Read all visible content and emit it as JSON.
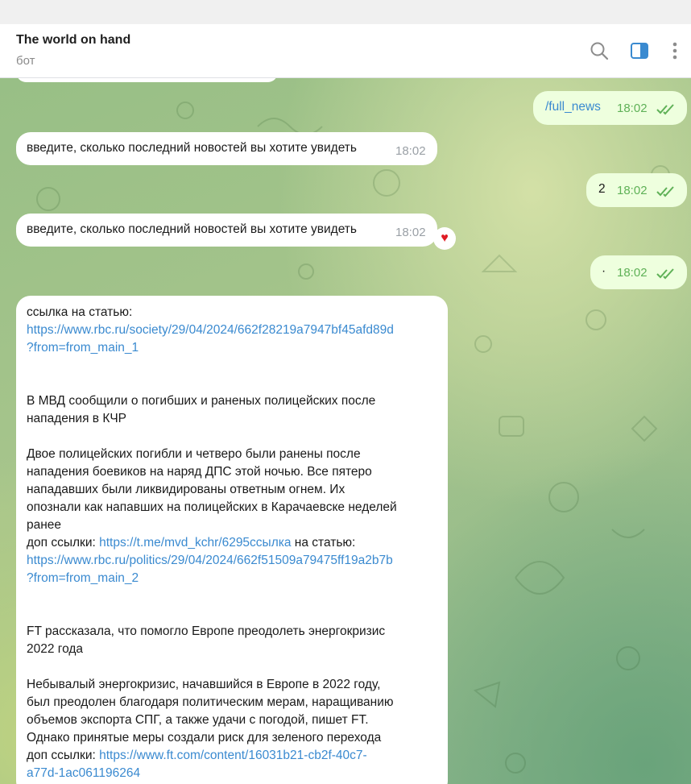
{
  "header": {
    "title": "The world on hand",
    "subtitle": "бот",
    "icons": [
      "search-icon",
      "sidebar-toggle-icon",
      "more-vertical-icon"
    ],
    "accent": "#3a8ad0"
  },
  "messages": [
    {
      "id": "out1",
      "direction": "out",
      "text": "/full_news",
      "time": "18:02",
      "read": true
    },
    {
      "id": "in1",
      "direction": "in",
      "text": "введите, сколько последний новостей вы хотите увидеть",
      "time": "18:02"
    },
    {
      "id": "out2",
      "direction": "out",
      "text": "2",
      "time": "18:02",
      "read": true
    },
    {
      "id": "in2",
      "direction": "in",
      "text": "введите, сколько последний новостей вы хотите увидеть",
      "time": "18:02",
      "reaction": "♥"
    },
    {
      "id": "out3",
      "direction": "out",
      "text": "·",
      "time": "18:02",
      "read": true
    }
  ],
  "article_message": {
    "intro": "ссылка на статью:",
    "link1_part1": "https://www.rbc.ru/society/29/04/2024/662f28219a7947bf45afd89d",
    "link1_part2": "?from=from_main_1",
    "news1_title_line1": "В МВД сообщили о погибших и раненых полицейских после",
    "news1_title_line2": "нападения в КЧР",
    "news1_body_line1": "Двое полицейских погибли и четверо были ранены после",
    "news1_body_line2": "нападения боевиков на наряд ДПС этой ночью. Все пятеро",
    "news1_body_line3": "нападавших были ликвидированы ответным огнем. Их",
    "news1_body_line4": "опознали как напавших на полицейских в Карачаевске неделей",
    "news1_body_line5": "ранее",
    "extra_links_label": "доп ссылки: ",
    "extra_link1": "https://t.me/mvd_kchr/6295ссылка",
    "extra_link1_suffix": " на статью:",
    "link2_part1": "https://www.rbc.ru/politics/29/04/2024/662f51509a79475ff19a2b7b",
    "link2_part2": "?from=from_main_2",
    "news2_title_line1": "FT рассказала, что помогло Европе преодолеть энергокризис",
    "news2_title_line2": "2022 года",
    "news2_body_line1": "Небывалый энергокризис, начавшийся в Европе в 2022 году,",
    "news2_body_line2": "был преодолен благодаря политическим мерам, наращиванию",
    "news2_body_line3": "объемов экспорта СПГ, а также удачи с погодой, пишет FT.",
    "news2_body_line4": "Однако принятые меры создали риск для зеленого перехода",
    "extra_links_label2": "доп ссылки: ",
    "extra_link2_part1": "https://www.ft.com/content/16031b21-cb2f-40c7-",
    "extra_link2_part2": "a77d-1ac061196264"
  }
}
